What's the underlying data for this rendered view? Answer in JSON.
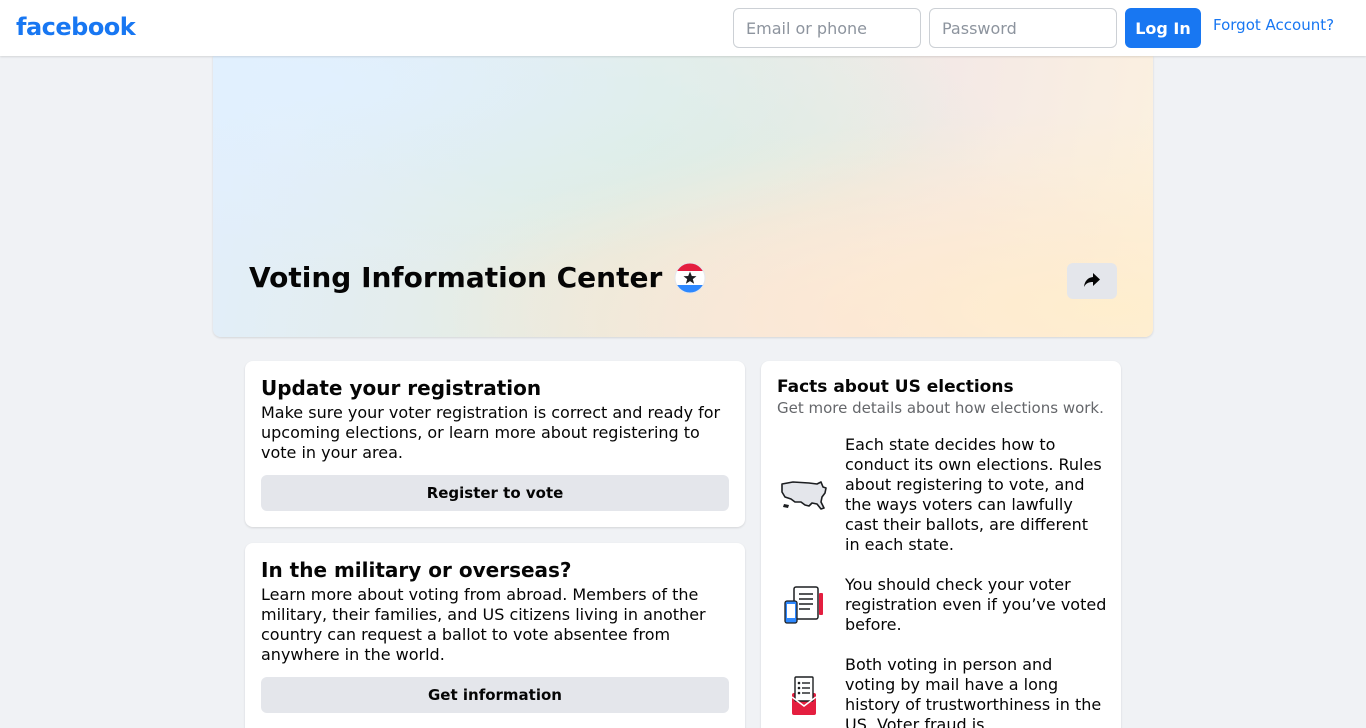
{
  "header": {
    "logo": "facebook",
    "email_placeholder": "Email or phone",
    "password_placeholder": "Password",
    "login_label": "Log In",
    "forgot_label": "Forgot Account?"
  },
  "hero": {
    "title": "Voting Information Center"
  },
  "registration": {
    "title": "Update your registration",
    "body": "Make sure your voter registration is correct and ready for upcoming elections, or learn more about registering to vote in your area.",
    "button": "Register to vote"
  },
  "military": {
    "title": "In the military or overseas?",
    "body": "Learn more about voting from abroad. Members of the military, their families, and US citizens living in another country can request a ballot to vote absentee from anywhere in the world.",
    "button": "Get information"
  },
  "facts": {
    "title": "Facts about US elections",
    "subtitle": "Get more details about how elections work.",
    "items": [
      {
        "icon": "us-map-icon",
        "text": "Each state decides how to conduct its own elections. Rules about registering to vote, and the ways voters can lawfully cast their ballots, are different in each state."
      },
      {
        "icon": "registration-phone-icon",
        "text": "You should check your voter registration even if you’ve voted before."
      },
      {
        "icon": "mail-ballot-icon",
        "text": "Both voting in person and voting by mail have a long history of trustworthiness in the US. Voter fraud is"
      }
    ]
  },
  "colors": {
    "brand": "#1877f2",
    "page_bg": "#f0f2f5",
    "secondary_button": "#e4e6eb"
  }
}
